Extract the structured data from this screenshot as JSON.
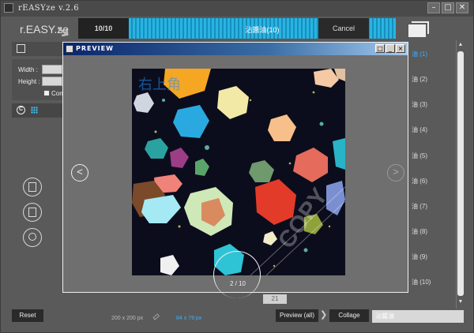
{
  "window": {
    "title": "rEASYze v.2.6",
    "min_label": "–",
    "max_label": "□",
    "close_label": "✕"
  },
  "header": {
    "logo": "r.EASY.ze",
    "progress_count": "10/10",
    "progress_label": "沾醬油(10)",
    "progress_fraction": 1.0,
    "cancel_label": "Cancel"
  },
  "left_panel": {
    "width_label": "Width :",
    "height_label": "Height :",
    "constrain_label": "Con"
  },
  "list": {
    "items": [
      {
        "label": "油 (1)",
        "selected": true
      },
      {
        "label": "油 (2)",
        "selected": false
      },
      {
        "label": "油 (3)",
        "selected": false
      },
      {
        "label": "油 (4)",
        "selected": false
      },
      {
        "label": "油 (5)",
        "selected": false
      },
      {
        "label": "油 (6)",
        "selected": false
      },
      {
        "label": "油 (7)",
        "selected": false
      },
      {
        "label": "油 (8)",
        "selected": false
      },
      {
        "label": "油 (9)",
        "selected": false
      },
      {
        "label": "油 (10)",
        "selected": false
      }
    ]
  },
  "preview": {
    "title": "PREVIEW",
    "overlay_text": "右上角",
    "watermark": "COPY",
    "pager": "2 / 10",
    "nav_prev": "<",
    "nav_next": ">"
  },
  "footer": {
    "reset_label": "Reset",
    "dim_left": "200 x 200 px",
    "dim_right": "84 x 79 px",
    "page_number": "21",
    "preview_all_label": "Preview (all)",
    "arrow": "❯",
    "collage_label": "Collage",
    "name_field_value": "沾醬油"
  },
  "colors": {
    "accent": "#3ab0ff",
    "progress": "#29b4e3",
    "panel": "#5a5a5a",
    "dialog_title": "#0a246a"
  }
}
